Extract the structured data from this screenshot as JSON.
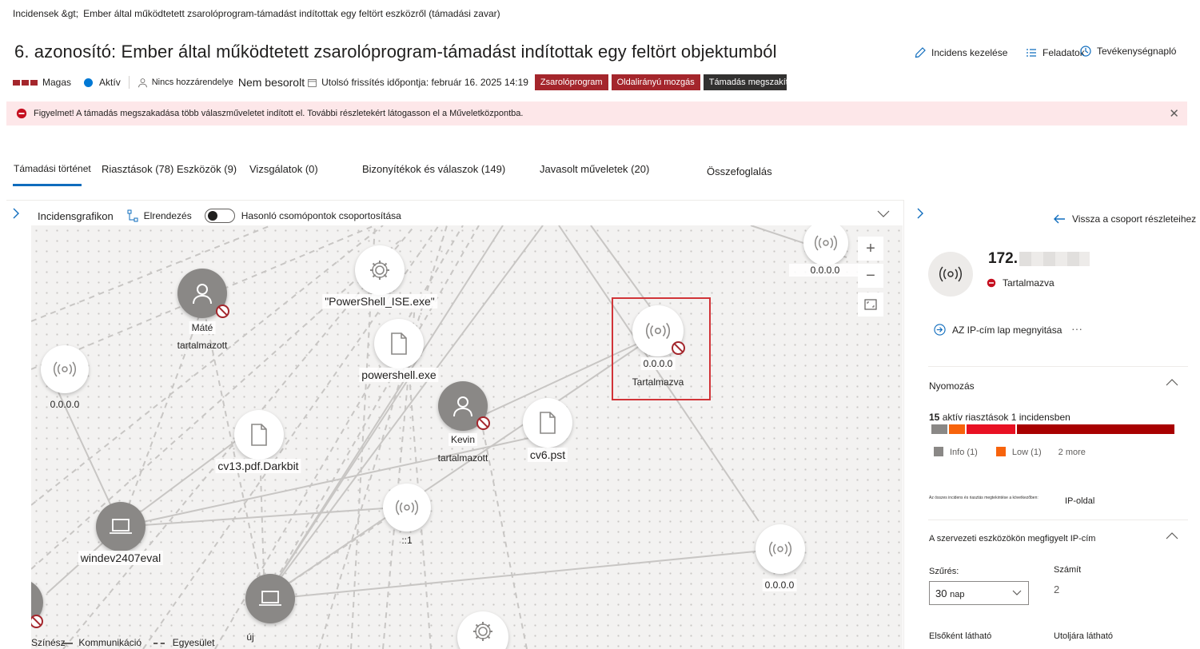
{
  "breadcrumb": {
    "root": "Incidensek &gt;",
    "current": "Ember által működtetett zsarolóprogram-támadást indítottak egy feltört eszközről (támadási zavar)"
  },
  "title": "6. azonosító: Ember által működtetett zsarolóprogram-támadást indítottak egy feltört objektumból",
  "actions": {
    "manage": "Incidens kezelése",
    "tasks": "Feladatok",
    "activity": "Tevékenységnapló"
  },
  "meta": {
    "severity": "Magas",
    "status": "Aktív",
    "assignee": "Nincs hozzárendelye",
    "classification": "Nem besorolt",
    "last_update": "Utolsó frissítés időpontja: február 16. 2025 14:19",
    "tags": [
      {
        "label": "Zsarolóprogram",
        "color": "#a4262c"
      },
      {
        "label": "Oldalirányú mozgás",
        "color": "#a4262c"
      },
      {
        "label": "Támadás megszakítás",
        "color": "#323130"
      }
    ]
  },
  "alert": {
    "text": "Figyelmet! A támadás megszakadása több válaszműveletet indított el. További részletekért látogasson el a Műveletközpontba."
  },
  "tabs": [
    "Támadási történet",
    "Riasztások (78)",
    "Eszközök (9)",
    "Vizsgálatok (0)",
    "Bizonyítékok és válaszok (149)",
    "Javasolt műveletek (20)",
    "Összefoglalás"
  ],
  "graph": {
    "title": "Incidensgrafikon",
    "layout": "Elrendezés",
    "group_toggle": "Hasonló csomópontok csoportosítása",
    "nodes": {
      "mate_name": "Máté",
      "mate_status": "tartalmazott",
      "powershell_ise": "\"PowerShell_ISE.exe\"",
      "powershell": "powershell.exe",
      "ip_left": "0.0.0.0",
      "ip_selected": "0.0.0.0",
      "ip_selected_status": "Tartalmazva",
      "ip_topright": "0.0.0.0",
      "ip_right": "0.0.0.0",
      "kevin_name": "Kevin",
      "kevin_status": "tartalmazott",
      "cv6": "cv6.pst",
      "cv13": "cv13.pdf.Darkbit",
      "ipv6": "::1",
      "windev": "windev2407eval",
      "new_device": "új"
    },
    "legend": {
      "color": "Színész",
      "comm": "Kommunikáció",
      "assoc": "Egyesület"
    }
  },
  "panel": {
    "back": "Vissza a csoport részleteihez",
    "ip": "172.",
    "status": "Tartalmazva",
    "open_page": "AZ IP-cím lap megnyitása",
    "more": "···",
    "investigation": {
      "title": "Nyomozás",
      "count": "15",
      "count_text": "aktív riasztások 1 incidensben",
      "legend_info": "Info (1)",
      "legend_low": "Low (1)",
      "legend_more": "2 more",
      "footnote": "Az összes incidens és riasztás megtekintése a következőben:",
      "ip_page": "IP-oldal"
    },
    "observed": {
      "title": "A szervezeti eszközökön megfigyelt IP-cím",
      "filter_label": "Szűrés:",
      "count_label": "Számít",
      "filter_number": "30",
      "filter_unit": "nap",
      "count_value": "2",
      "first_seen": "Elsőként látható",
      "last_seen": "Utoljára látható"
    }
  },
  "colors": {
    "accent": "#0f6cbd",
    "alert_bg": "#fde7e9",
    "high": "#a4262c"
  }
}
